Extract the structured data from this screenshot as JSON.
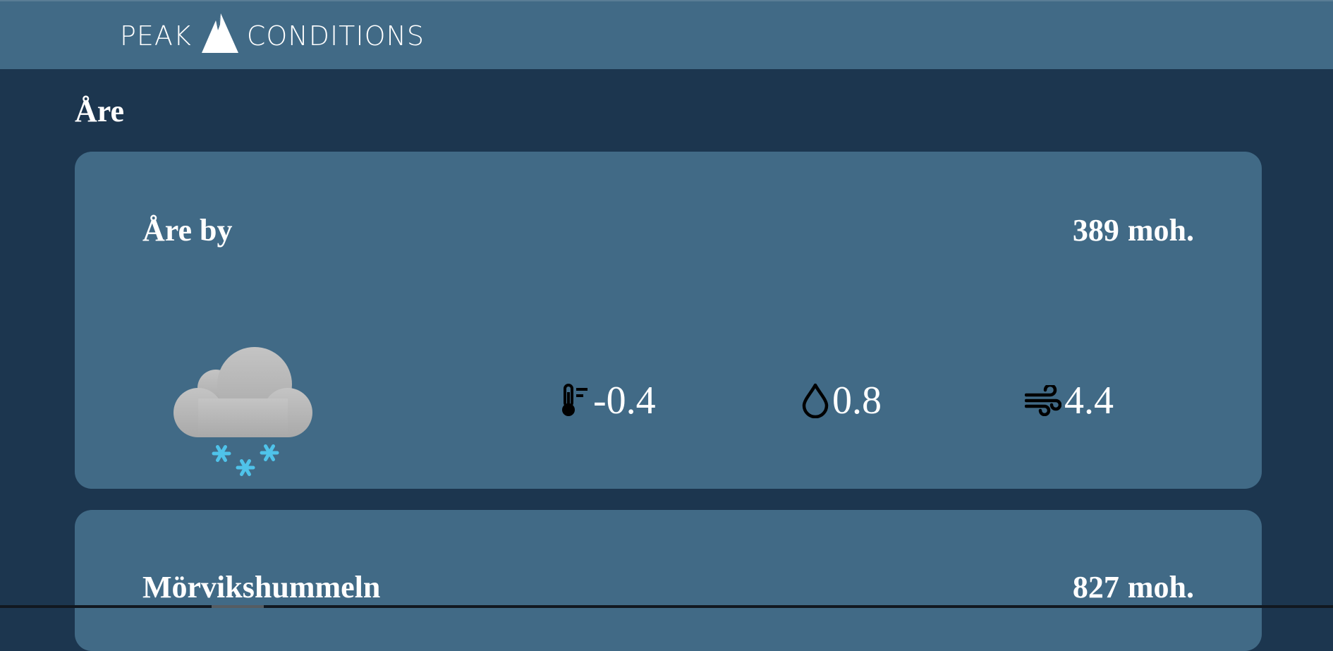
{
  "header": {
    "logo_left": "PEAK",
    "logo_right": "CONDITIONS",
    "logo_icon": "mountain-icon"
  },
  "region": {
    "title": "Åre"
  },
  "stations": [
    {
      "name": "Åre by",
      "elevation_value": "389",
      "elevation_unit": "moh.",
      "weather_icon": "cloud-snow-icon",
      "temperature": "-0.4",
      "precipitation": "0.8",
      "wind": "4.4"
    },
    {
      "name": "Mörvikshummeln",
      "elevation_value": "827",
      "elevation_unit": "moh."
    }
  ],
  "colors": {
    "page_background": "#1c364f",
    "header_background": "#416a86",
    "card_background": "#416a86",
    "snowflake": "#4fc3ea",
    "cloud": "#b9b9b9",
    "text": "#ffffff",
    "metric_icon": "#000000"
  }
}
